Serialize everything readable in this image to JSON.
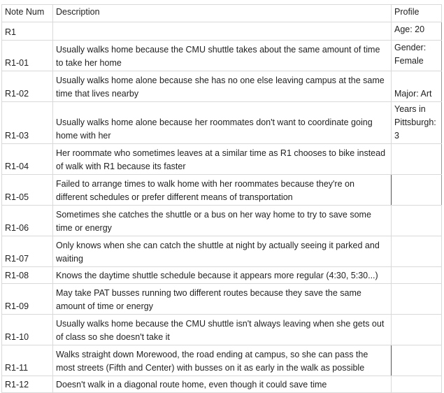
{
  "columns": [
    "Note Num",
    "Description",
    "Profile"
  ],
  "rows": [
    {
      "note": "R1",
      "description": "",
      "profile": "Age: 20"
    },
    {
      "note": "R1-01",
      "description": "Usually walks home because the CMU shuttle takes about the same amount of time to take her home",
      "profile": "Gender: Female"
    },
    {
      "note": "R1-02",
      "description": "Usually walks home alone because she has no one else leaving campus at the same time that lives nearby",
      "profile": "Major: Art"
    },
    {
      "note": "R1-03",
      "description": "Usually walks home alone because her roommates don't want to coordinate going home with her",
      "profile": "Years in Pittsburgh: 3"
    },
    {
      "note": "R1-04",
      "description": "Her roommate who sometimes leaves at a similar time as R1 chooses to bike instead of walk with R1 because its faster",
      "profile": ""
    },
    {
      "note": "R1-05",
      "description": "Failed to arrange times to walk home with her roommates because they're on different schedules or prefer different means of transportation",
      "profile": ""
    },
    {
      "note": "R1-06",
      "description": "Sometimes she catches the shuttle or a bus on her way home to try to save some time or energy",
      "profile": ""
    },
    {
      "note": "R1-07",
      "description": "Only knows when she can catch the shuttle at night by actually seeing it parked and waiting",
      "profile": ""
    },
    {
      "note": "R1-08",
      "description": "Knows the daytime shuttle schedule because it appears more regular (4:30, 5:30...)",
      "profile": ""
    },
    {
      "note": "R1-09",
      "description": "May take PAT busses running two different routes because they save the same amount of time or energy",
      "profile": ""
    },
    {
      "note": "R1-10",
      "description": "Usually walks home because the CMU shuttle isn't always leaving when she gets out of class so she doesn't take it",
      "profile": ""
    },
    {
      "note": "R1-11",
      "description": "Walks straight down Morewood, the road ending at campus, so she can pass the most streets (Fifth and Center) with busses on it as early in the walk as possible",
      "profile": ""
    },
    {
      "note": "R1-12",
      "description": "Doesn't walk in a diagonal route home, even though it could save time",
      "profile": ""
    }
  ]
}
